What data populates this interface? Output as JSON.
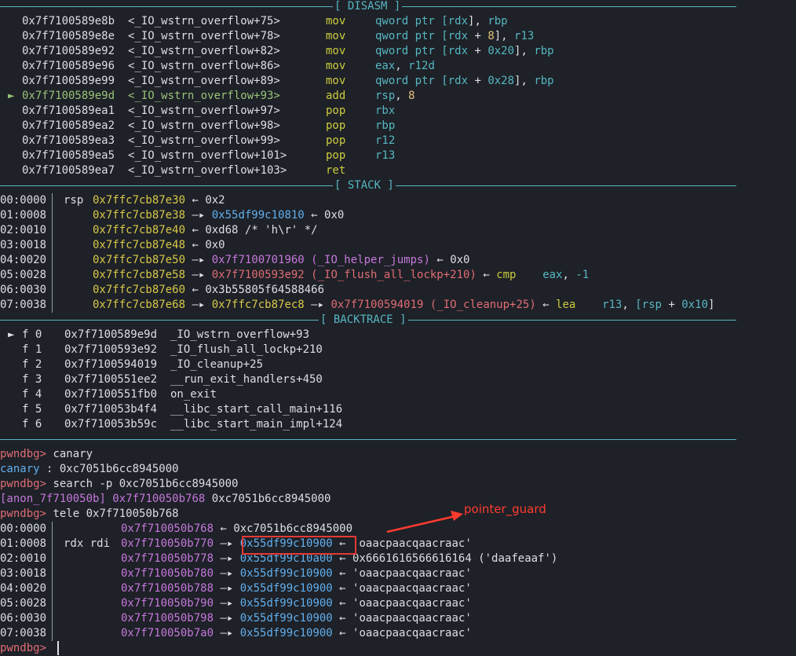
{
  "sections": {
    "disasm": "[ DISASM ]",
    "stack": "[ STACK ]",
    "backtrace": "[ BACKTRACE ]"
  },
  "disasm": [
    {
      "marker": "",
      "addr": "0x7f7100589e8b",
      "sym": "<_IO_wstrn_overflow+75>",
      "mnem": "mov",
      "ops": [
        [
          "qword ptr ",
          "cyan"
        ],
        [
          "[rdx",
          "cyan"
        ],
        [
          "], ",
          "white"
        ],
        [
          "rbp",
          "cyan"
        ]
      ]
    },
    {
      "marker": "",
      "addr": "0x7f7100589e8e",
      "sym": "<_IO_wstrn_overflow+78>",
      "mnem": "mov",
      "ops": [
        [
          "qword ptr ",
          "cyan"
        ],
        [
          "[rdx",
          "cyan"
        ],
        [
          " + ",
          "white"
        ],
        [
          "8",
          "orange"
        ],
        [
          "], ",
          "white"
        ],
        [
          "r13",
          "cyan"
        ]
      ]
    },
    {
      "marker": "",
      "addr": "0x7f7100589e92",
      "sym": "<_IO_wstrn_overflow+82>",
      "mnem": "mov",
      "ops": [
        [
          "qword ptr ",
          "cyan"
        ],
        [
          "[rdx",
          "cyan"
        ],
        [
          " + ",
          "white"
        ],
        [
          "0x20",
          "cyan"
        ],
        [
          "], ",
          "white"
        ],
        [
          "rbp",
          "cyan"
        ]
      ]
    },
    {
      "marker": "",
      "addr": "0x7f7100589e96",
      "sym": "<_IO_wstrn_overflow+86>",
      "mnem": "mov",
      "ops": [
        [
          "eax",
          "cyan"
        ],
        [
          ", ",
          "white"
        ],
        [
          "r12d",
          "cyan"
        ]
      ]
    },
    {
      "marker": "",
      "addr": "0x7f7100589e99",
      "sym": "<_IO_wstrn_overflow+89>",
      "mnem": "mov",
      "ops": [
        [
          "qword ptr ",
          "cyan"
        ],
        [
          "[rdx",
          "cyan"
        ],
        [
          " + ",
          "white"
        ],
        [
          "0x28",
          "cyan"
        ],
        [
          "], ",
          "white"
        ],
        [
          "rbp",
          "cyan"
        ]
      ]
    },
    {
      "marker": "►",
      "addr": "0x7f7100589e9d",
      "sym": "<_IO_wstrn_overflow+93>",
      "mnem": "add",
      "ops": [
        [
          "rsp",
          "cyan"
        ],
        [
          ", ",
          "white"
        ],
        [
          "8",
          "orange"
        ]
      ],
      "current": true
    },
    {
      "marker": "",
      "addr": "0x7f7100589ea1",
      "sym": "<_IO_wstrn_overflow+97>",
      "mnem": "pop",
      "ops": [
        [
          "rbx",
          "cyan"
        ]
      ]
    },
    {
      "marker": "",
      "addr": "0x7f7100589ea2",
      "sym": "<_IO_wstrn_overflow+98>",
      "mnem": "pop",
      "ops": [
        [
          "rbp",
          "cyan"
        ]
      ]
    },
    {
      "marker": "",
      "addr": "0x7f7100589ea3",
      "sym": "<_IO_wstrn_overflow+99>",
      "mnem": "pop",
      "ops": [
        [
          "r12",
          "cyan"
        ]
      ]
    },
    {
      "marker": "",
      "addr": "0x7f7100589ea5",
      "sym": "<_IO_wstrn_overflow+101>",
      "mnem": "pop",
      "ops": [
        [
          "r13",
          "cyan"
        ]
      ]
    },
    {
      "marker": "",
      "addr": "0x7f7100589ea7",
      "sym": "<_IO_wstrn_overflow+103>",
      "mnem": "ret",
      "ops": []
    }
  ],
  "stack": [
    {
      "off": "00:0000",
      "reg": "rsp",
      "parts": [
        [
          "0x7ffc7cb87e30",
          "yellow"
        ],
        [
          " ← ",
          "white"
        ],
        [
          "0x2",
          "white"
        ]
      ]
    },
    {
      "off": "01:0008",
      "reg": "",
      "parts": [
        [
          "0x7ffc7cb87e38",
          "yellow"
        ],
        [
          " —▸ ",
          "white"
        ],
        [
          "0x55df99c10810",
          "blue"
        ],
        [
          " ← ",
          "white"
        ],
        [
          "0x0",
          "white"
        ]
      ]
    },
    {
      "off": "02:0010",
      "reg": "",
      "parts": [
        [
          "0x7ffc7cb87e40",
          "yellow"
        ],
        [
          " ← ",
          "white"
        ],
        [
          "0xd68 /* 'h\\r' */",
          "white"
        ]
      ]
    },
    {
      "off": "03:0018",
      "reg": "",
      "parts": [
        [
          "0x7ffc7cb87e48",
          "yellow"
        ],
        [
          " ← ",
          "white"
        ],
        [
          "0x0",
          "white"
        ]
      ]
    },
    {
      "off": "04:0020",
      "reg": "",
      "parts": [
        [
          "0x7ffc7cb87e50",
          "yellow"
        ],
        [
          " —▸ ",
          "white"
        ],
        [
          "0x7f7100701960 (_IO_helper_jumps)",
          "purple"
        ],
        [
          " ← ",
          "white"
        ],
        [
          "0x0",
          "white"
        ]
      ]
    },
    {
      "off": "05:0028",
      "reg": "",
      "parts": [
        [
          "0x7ffc7cb87e58",
          "yellow"
        ],
        [
          " —▸ ",
          "white"
        ],
        [
          "0x7f7100593e92 (_IO_flush_all_lockp+210)",
          "red"
        ],
        [
          " ← ",
          "white"
        ],
        [
          "cmp",
          "op"
        ],
        [
          "    ",
          "white"
        ],
        [
          "eax",
          "cyan"
        ],
        [
          ", ",
          "white"
        ],
        [
          "-1",
          "cyan"
        ]
      ]
    },
    {
      "off": "06:0030",
      "reg": "",
      "parts": [
        [
          "0x7ffc7cb87e60",
          "yellow"
        ],
        [
          " ← ",
          "white"
        ],
        [
          "0x3b55805f64588466",
          "white"
        ]
      ]
    },
    {
      "off": "07:0038",
      "reg": "",
      "parts": [
        [
          "0x7ffc7cb87e68",
          "yellow"
        ],
        [
          " —▸ ",
          "white"
        ],
        [
          "0x7ffc7cb87ec8",
          "yellow"
        ],
        [
          " —▸ ",
          "white"
        ],
        [
          "0x7f7100594019 (_IO_cleanup+25)",
          "red"
        ],
        [
          " ← ",
          "white"
        ],
        [
          "lea",
          "op"
        ],
        [
          "    ",
          "white"
        ],
        [
          "r13",
          "cyan"
        ],
        [
          ", ",
          "white"
        ],
        [
          "[rsp",
          "cyan"
        ],
        [
          " + ",
          "white"
        ],
        [
          "0x10",
          "cyan"
        ],
        [
          "]",
          "white"
        ]
      ]
    }
  ],
  "backtrace": [
    {
      "marker": "►",
      "frame": "f 0",
      "addr": "0x7f7100589e9d",
      "sym": "_IO_wstrn_overflow+93"
    },
    {
      "marker": "",
      "frame": "f 1",
      "addr": "0x7f7100593e92",
      "sym": "_IO_flush_all_lockp+210"
    },
    {
      "marker": "",
      "frame": "f 2",
      "addr": "0x7f7100594019",
      "sym": "_IO_cleanup+25"
    },
    {
      "marker": "",
      "frame": "f 3",
      "addr": "0x7f7100551ee2",
      "sym": "__run_exit_handlers+450"
    },
    {
      "marker": "",
      "frame": "f 4",
      "addr": "0x7f7100551fb0",
      "sym": "on_exit"
    },
    {
      "marker": "",
      "frame": "f 5",
      "addr": "0x7f710053b4f4",
      "sym": "__libc_start_call_main+116"
    },
    {
      "marker": "",
      "frame": "f 6",
      "addr": "0x7f710053b59c",
      "sym": "__libc_start_main_impl+124"
    }
  ],
  "console": [
    [
      [
        "pwndbg> ",
        "red"
      ],
      [
        "canary",
        "white"
      ]
    ],
    [
      [
        "canary",
        "blue"
      ],
      [
        " : ",
        "white"
      ],
      [
        "0xc7051b6cc8945000",
        "white"
      ]
    ],
    [
      [
        "pwndbg> ",
        "red"
      ],
      [
        "search -p 0xc7051b6cc8945000",
        "white"
      ]
    ],
    [
      [
        "[anon_7f710050b]",
        "purple"
      ],
      [
        " ",
        "white"
      ],
      [
        "0x7f710050b768",
        "purple"
      ],
      [
        " 0xc7051b6cc8945000",
        "white"
      ]
    ],
    [
      [
        "pwndbg> ",
        "red"
      ],
      [
        "tele 0x7f710050b768",
        "white"
      ]
    ]
  ],
  "tele": [
    {
      "off": "00:0000",
      "reg": "",
      "parts": [
        [
          "0x7f710050b768",
          "purple"
        ],
        [
          " ← ",
          "white"
        ],
        [
          "0xc7051b6cc8945000",
          "white"
        ]
      ]
    },
    {
      "off": "01:0008",
      "reg": "rdx rdi",
      "parts": [
        [
          "0x7f710050b770",
          "purple"
        ],
        [
          " —▸ ",
          "white"
        ],
        [
          "0x55df99c10900",
          "blue"
        ],
        [
          " ← ",
          "white"
        ],
        [
          "'oaacpaacqaacraac'",
          "white"
        ]
      ]
    },
    {
      "off": "02:0010",
      "reg": "",
      "parts": [
        [
          "0x7f710050b778",
          "purple"
        ],
        [
          " —▸ ",
          "white"
        ],
        [
          "0x55df99c10a00",
          "blue"
        ],
        [
          " ← ",
          "white"
        ],
        [
          "0x6661616566616164 ('daafeaaf')",
          "white"
        ]
      ]
    },
    {
      "off": "03:0018",
      "reg": "",
      "parts": [
        [
          "0x7f710050b780",
          "purple"
        ],
        [
          " —▸ ",
          "white"
        ],
        [
          "0x55df99c10900",
          "blue"
        ],
        [
          " ← ",
          "white"
        ],
        [
          "'oaacpaacqaacraac'",
          "white"
        ]
      ]
    },
    {
      "off": "04:0020",
      "reg": "",
      "parts": [
        [
          "0x7f710050b788",
          "purple"
        ],
        [
          " —▸ ",
          "white"
        ],
        [
          "0x55df99c10900",
          "blue"
        ],
        [
          " ← ",
          "white"
        ],
        [
          "'oaacpaacqaacraac'",
          "white"
        ]
      ]
    },
    {
      "off": "05:0028",
      "reg": "",
      "parts": [
        [
          "0x7f710050b790",
          "purple"
        ],
        [
          " —▸ ",
          "white"
        ],
        [
          "0x55df99c10900",
          "blue"
        ],
        [
          " ← ",
          "white"
        ],
        [
          "'oaacpaacqaacraac'",
          "white"
        ]
      ]
    },
    {
      "off": "06:0030",
      "reg": "",
      "parts": [
        [
          "0x7f710050b798",
          "purple"
        ],
        [
          " —▸ ",
          "white"
        ],
        [
          "0x55df99c10900",
          "blue"
        ],
        [
          " ← ",
          "white"
        ],
        [
          "'oaacpaacqaacraac'",
          "white"
        ]
      ]
    },
    {
      "off": "07:0038",
      "reg": "",
      "parts": [
        [
          "0x7f710050b7a0",
          "purple"
        ],
        [
          " —▸ ",
          "white"
        ],
        [
          "0x55df99c10900",
          "blue"
        ],
        [
          " ← ",
          "white"
        ],
        [
          "'oaacpaacqaacraac'",
          "white"
        ]
      ]
    }
  ],
  "prompt": "pwndbg> ",
  "annotation": "pointer_guard",
  "colors": {
    "background": "#1e2127",
    "separator": "#56b6c2",
    "prompt": "#e06c75",
    "annotation": "#ff3b30"
  }
}
